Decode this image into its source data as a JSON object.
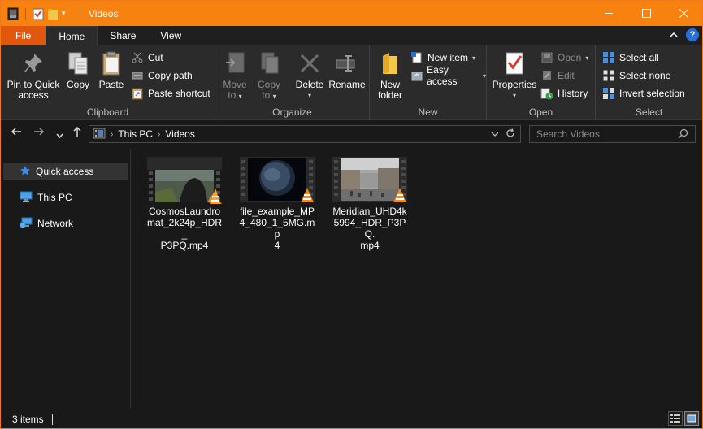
{
  "window": {
    "title": "Videos"
  },
  "tabs": {
    "file": "File",
    "home": "Home",
    "share": "Share",
    "view": "View"
  },
  "ribbon": {
    "clipboard": {
      "label": "Clipboard",
      "pin_line1": "Pin to Quick",
      "pin_line2": "access",
      "copy": "Copy",
      "paste": "Paste",
      "cut": "Cut",
      "copy_path": "Copy path",
      "paste_shortcut": "Paste shortcut"
    },
    "organize": {
      "label": "Organize",
      "move_line1": "Move",
      "move_line2": "to",
      "copy_line1": "Copy",
      "copy_line2": "to",
      "delete": "Delete",
      "rename": "Rename"
    },
    "new": {
      "label": "New",
      "folder_line1": "New",
      "folder_line2": "folder",
      "new_item": "New item",
      "easy_access": "Easy access"
    },
    "open": {
      "label": "Open",
      "properties": "Properties",
      "open": "Open",
      "edit": "Edit",
      "history": "History"
    },
    "select": {
      "label": "Select",
      "select_all": "Select all",
      "select_none": "Select none",
      "invert": "Invert selection"
    }
  },
  "address": {
    "crumbs": [
      "This PC",
      "Videos"
    ]
  },
  "search": {
    "placeholder": "Search Videos"
  },
  "nav": {
    "items": [
      {
        "label": "Quick access",
        "icon": "star-icon"
      },
      {
        "label": "This PC",
        "icon": "monitor-icon"
      },
      {
        "label": "Network",
        "icon": "network-icon"
      }
    ]
  },
  "files": [
    {
      "name": "CosmosLaundromat_2k24p_HDR_P3PQ.mp4",
      "line1": "CosmosLaundro",
      "line2": "mat_2k24p_HDR_",
      "line3": "P3PQ.mp4"
    },
    {
      "name": "file_example_MP4_480_1_5MG.mp4",
      "line1": "file_example_MP",
      "line2": "4_480_1_5MG.mp",
      "line3": "4"
    },
    {
      "name": "Meridian_UHD4k5994_HDR_P3PQ.mp4",
      "line1": "Meridian_UHD4k",
      "line2": "5994_HDR_P3PQ.",
      "line3": "mp4"
    }
  ],
  "status": {
    "count": "3 items"
  },
  "colors": {
    "accent": "#f7820f",
    "file_tab": "#e2570e",
    "background": "#191919",
    "ribbon": "#2b2b2b"
  }
}
